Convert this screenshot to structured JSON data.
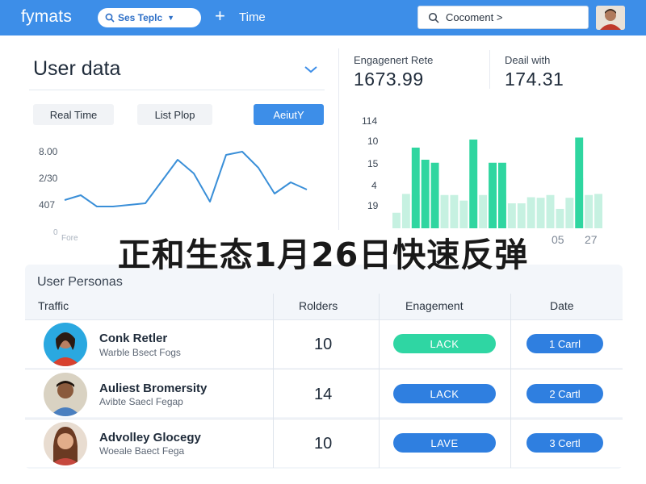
{
  "header": {
    "brand": "fymats",
    "pill_label": "Ses Teplc",
    "time_label": "Time",
    "search_placeholder": "Cocoment >"
  },
  "user_data": {
    "title": "User data",
    "tabs": [
      "Real Time",
      "List Plop",
      "AeiutY"
    ],
    "line_chart": {
      "y_ticks": [
        "8.00",
        "2/30",
        "407",
        "0"
      ],
      "x_tick_left": "Fore"
    }
  },
  "stats": [
    {
      "label": "Engagenert Rete",
      "value": "1673.99"
    },
    {
      "label": "Deail with",
      "value": "174.31"
    }
  ],
  "bar_chart_axis": {
    "y_ticks": [
      "114",
      "10",
      "15",
      "4",
      "19"
    ],
    "x_ticks": [
      "05",
      "27"
    ]
  },
  "chart_data": [
    {
      "type": "line",
      "title": "",
      "xlabel": "",
      "ylabel": "",
      "x": [
        0,
        1,
        2,
        3,
        4,
        5,
        6,
        7,
        8,
        9,
        10,
        11,
        12
      ],
      "series": [
        {
          "values": [
            0.22,
            0.28,
            0.14,
            0.14,
            0.16,
            0.18,
            0.45,
            0.72,
            0.55,
            0.2,
            0.78,
            0.82,
            0.62,
            0.3,
            0.44,
            0.35
          ]
        }
      ],
      "ylim": [
        0,
        1
      ]
    },
    {
      "type": "bar",
      "title": "",
      "xlabel": "",
      "ylabel": "",
      "series": [
        {
          "values": [
            0.28,
            0.62,
            0.6,
            0.68,
            0.65,
            0.6,
            0.6,
            0.5,
            0.88,
            0.6,
            0.65,
            0.6,
            0.45,
            0.45,
            0.56,
            0.55,
            0.6,
            0.35,
            0.55,
            0.9,
            0.6,
            0.62
          ]
        },
        {
          "values": [
            0.0,
            0.0,
            0.35,
            0.32,
            0.45,
            0.0,
            0.0,
            0.0,
            0.0,
            0.0,
            0.0,
            0.2,
            0.0,
            0.0,
            0.0,
            0.0,
            0.0,
            0.0,
            0.0,
            0.0,
            0.0,
            0.0
          ]
        }
      ],
      "ylim": [
        0,
        1
      ]
    }
  ],
  "headline": "正和生态1月26日快速反弹",
  "personas": {
    "title": "User Personas",
    "columns": [
      "Traffic",
      "Rolders",
      "Enagement",
      "Date"
    ],
    "rows": [
      {
        "name": "Conk Retler",
        "sub": "Warble Bsect Fogs",
        "count": "10",
        "status": "LACK",
        "date": "1 Carrl"
      },
      {
        "name": "Auliest Bromersity",
        "sub": "Avibte Saecl Fegap",
        "count": "14",
        "status": "LACK",
        "date": "2 Cartl"
      },
      {
        "name": "Advolley Glocegy",
        "sub": "Woeale Baect Fega",
        "count": "10",
        "status": "LAVE",
        "date": "3 Certl"
      }
    ]
  },
  "colors": {
    "header_bg": "#3d8ee8",
    "accent_blue": "#3d8ee8",
    "line_blue": "#3a8fd8",
    "bar_green": "#2fd6a0",
    "bar_light": "#c6f1e1",
    "status_teal": "#2fd6a3",
    "status_blue": "#2f7fe0"
  },
  "icons": [
    "search-icon",
    "plus-icon",
    "chevron-down-icon",
    "avatar"
  ]
}
